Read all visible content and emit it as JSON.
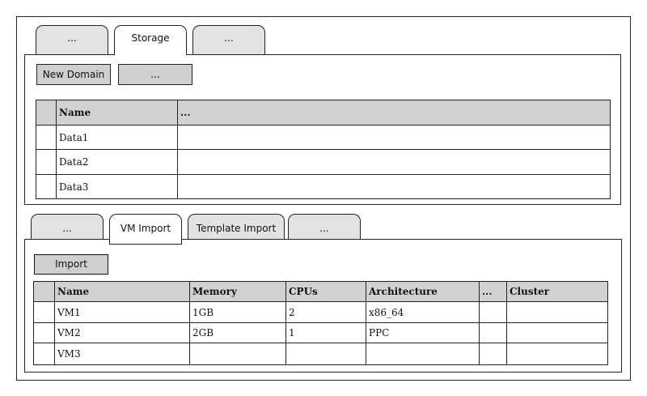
{
  "top": {
    "tabs": [
      {
        "label": "...",
        "active": false
      },
      {
        "label": "Storage",
        "active": true
      },
      {
        "label": "...",
        "active": false
      }
    ],
    "buttons": {
      "new_domain": "New Domain",
      "more": "..."
    },
    "columns": [
      "Name",
      "..."
    ],
    "rows": [
      [
        "Data1",
        ""
      ],
      [
        "Data2",
        ""
      ],
      [
        "Data3",
        ""
      ]
    ]
  },
  "bottom": {
    "tabs": [
      {
        "label": "...",
        "active": false
      },
      {
        "label": "VM Import",
        "active": true
      },
      {
        "label": "Template Import",
        "active": false
      },
      {
        "label": "...",
        "active": false
      }
    ],
    "buttons": {
      "import": "Import"
    },
    "columns": [
      "Name",
      "Memory",
      "CPUs",
      "Architecture",
      "...",
      "Cluster"
    ],
    "rows": [
      [
        "VM1",
        "1GB",
        "2",
        "x86_64",
        "",
        ""
      ],
      [
        "VM2",
        "2GB",
        "1",
        "PPC",
        "",
        ""
      ],
      [
        "VM3",
        "",
        "",
        "",
        "",
        ""
      ]
    ]
  }
}
